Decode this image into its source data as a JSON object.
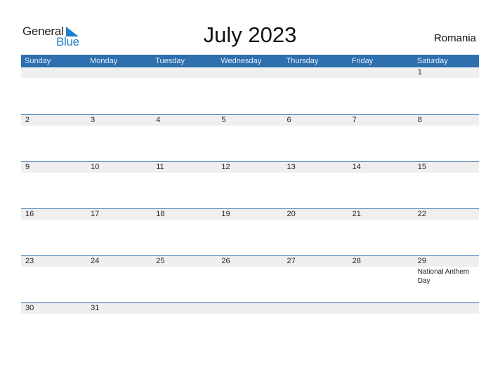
{
  "logo": {
    "line1": "General",
    "line2": "Blue"
  },
  "header": {
    "title": "July 2023",
    "country": "Romania"
  },
  "colors": {
    "accent": "#2e6fb0",
    "band": "#efefef",
    "logo_blue": "#1f7fcf"
  },
  "weekdays": [
    "Sunday",
    "Monday",
    "Tuesday",
    "Wednesday",
    "Thursday",
    "Friday",
    "Saturday"
  ],
  "weeks": [
    {
      "days": [
        "",
        "",
        "",
        "",
        "",
        "",
        "1"
      ],
      "events": [
        "",
        "",
        "",
        "",
        "",
        "",
        ""
      ]
    },
    {
      "days": [
        "2",
        "3",
        "4",
        "5",
        "6",
        "7",
        "8"
      ],
      "events": [
        "",
        "",
        "",
        "",
        "",
        "",
        ""
      ]
    },
    {
      "days": [
        "9",
        "10",
        "11",
        "12",
        "13",
        "14",
        "15"
      ],
      "events": [
        "",
        "",
        "",
        "",
        "",
        "",
        ""
      ]
    },
    {
      "days": [
        "16",
        "17",
        "18",
        "19",
        "20",
        "21",
        "22"
      ],
      "events": [
        "",
        "",
        "",
        "",
        "",
        "",
        ""
      ]
    },
    {
      "days": [
        "23",
        "24",
        "25",
        "26",
        "27",
        "28",
        "29"
      ],
      "events": [
        "",
        "",
        "",
        "",
        "",
        "",
        "National Anthem Day"
      ]
    },
    {
      "days": [
        "30",
        "31",
        "",
        "",
        "",
        "",
        ""
      ],
      "events": [
        "",
        "",
        "",
        "",
        "",
        "",
        ""
      ]
    }
  ]
}
